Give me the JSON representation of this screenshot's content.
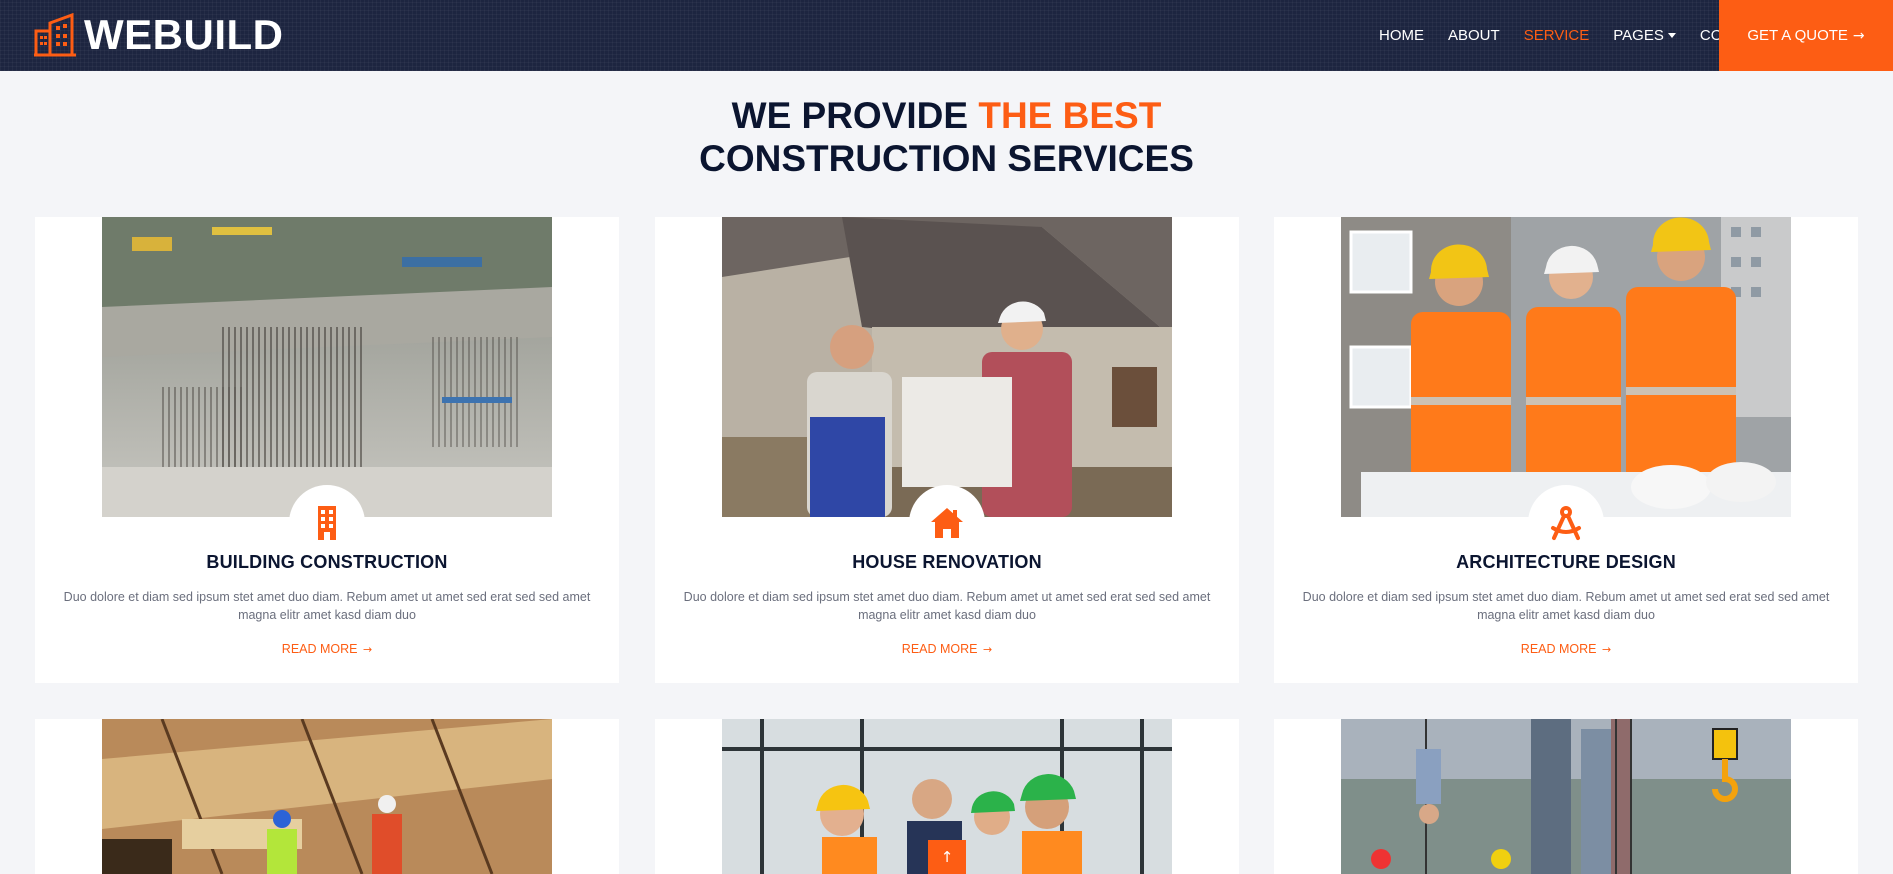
{
  "brand": {
    "name": "WEBUILD",
    "icon": "building-logo-icon"
  },
  "nav": {
    "links": [
      {
        "label": "HOME",
        "active": false
      },
      {
        "label": "ABOUT",
        "active": false
      },
      {
        "label": "SERVICE",
        "active": true
      },
      {
        "label": "PAGES",
        "active": false,
        "dropdown": true
      },
      {
        "label": "CONTACT",
        "active": false
      }
    ],
    "cta_label": "GET A QUOTE",
    "cta_arrow": "→"
  },
  "section": {
    "heading_part1": "WE PROVIDE",
    "heading_accent": "THE BEST",
    "heading_line2": "CONSTRUCTION SERVICES"
  },
  "services": [
    {
      "title": "BUILDING CONSTRUCTION",
      "text": "Duo dolore et diam sed ipsum stet amet duo diam. Rebum amet ut amet sed erat sed sed amet magna elitr amet kasd diam duo",
      "link": "READ MORE",
      "icon": "building-icon"
    },
    {
      "title": "HOUSE RENOVATION",
      "text": "Duo dolore et diam sed ipsum stet amet duo diam. Rebum amet ut amet sed erat sed sed amet magna elitr amet kasd diam duo",
      "link": "READ MORE",
      "icon": "house-icon"
    },
    {
      "title": "ARCHITECTURE DESIGN",
      "text": "Duo dolore et diam sed ipsum stet amet duo diam. Rebum amet ut amet sed erat sed sed amet magna elitr amet kasd diam duo",
      "link": "READ MORE",
      "icon": "compass-icon"
    }
  ],
  "link_arrow": "→",
  "back_to_top": "↑",
  "colors": {
    "accent": "#fd5d14",
    "navy": "#1d2540",
    "text_dark": "#0b1530"
  }
}
